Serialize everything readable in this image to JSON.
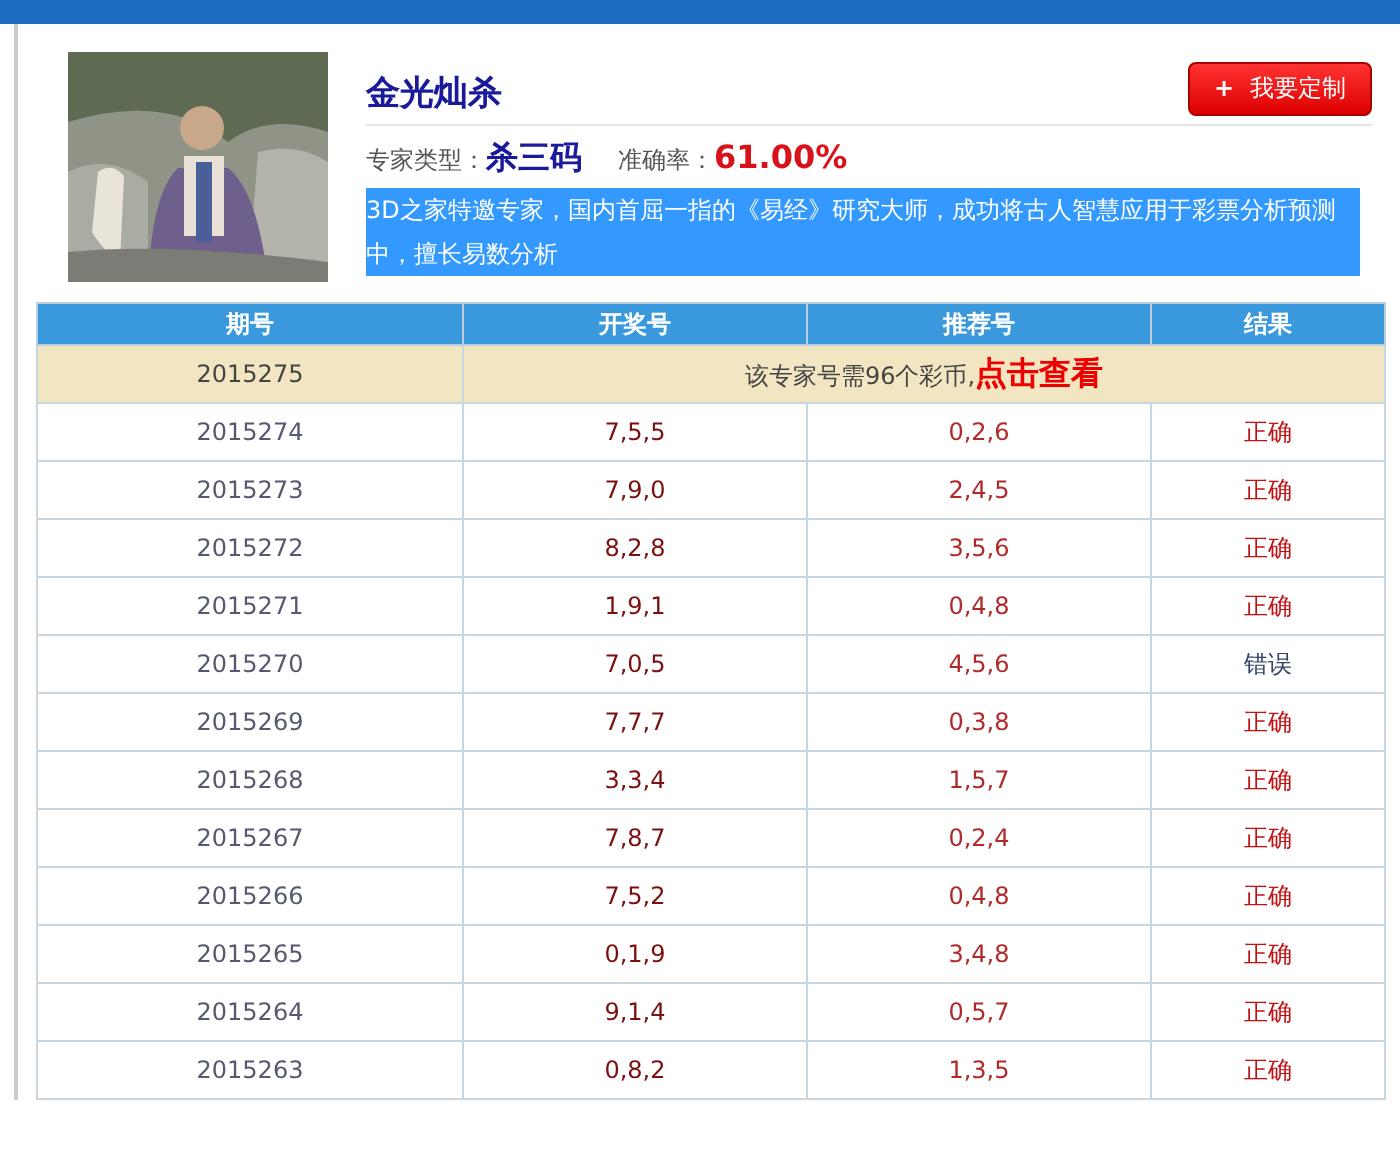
{
  "expert": {
    "name": "金光灿杀",
    "button": "我要定制",
    "button_icon": "+",
    "type_label": "专家类型：",
    "type_value": "杀三码",
    "accuracy_label": "准确率：",
    "accuracy_value": "61.00%",
    "description": "3D之家特邀专家，国内首屈一指的《易经》研究大师，成功将古人智慧应用于彩票分析预测中，擅长易数分析"
  },
  "table": {
    "columns": [
      "期号",
      "开奖号",
      "推荐号",
      "结果"
    ],
    "locked_row": {
      "issue": "2015275",
      "notice": "该专家号需96个彩币,",
      "link": "点击查看"
    },
    "rows": [
      {
        "issue": "2015274",
        "draw": "7,5,5",
        "pick": "0,2,6",
        "result": "正确",
        "correct": true
      },
      {
        "issue": "2015273",
        "draw": "7,9,0",
        "pick": "2,4,5",
        "result": "正确",
        "correct": true
      },
      {
        "issue": "2015272",
        "draw": "8,2,8",
        "pick": "3,5,6",
        "result": "正确",
        "correct": true
      },
      {
        "issue": "2015271",
        "draw": "1,9,1",
        "pick": "0,4,8",
        "result": "正确",
        "correct": true
      },
      {
        "issue": "2015270",
        "draw": "7,0,5",
        "pick": "4,5,6",
        "result": "错误",
        "correct": false
      },
      {
        "issue": "2015269",
        "draw": "7,7,7",
        "pick": "0,3,8",
        "result": "正确",
        "correct": true
      },
      {
        "issue": "2015268",
        "draw": "3,3,4",
        "pick": "1,5,7",
        "result": "正确",
        "correct": true
      },
      {
        "issue": "2015267",
        "draw": "7,8,7",
        "pick": "0,2,4",
        "result": "正确",
        "correct": true
      },
      {
        "issue": "2015266",
        "draw": "7,5,2",
        "pick": "0,4,8",
        "result": "正确",
        "correct": true
      },
      {
        "issue": "2015265",
        "draw": "0,1,9",
        "pick": "3,4,8",
        "result": "正确",
        "correct": true
      },
      {
        "issue": "2015264",
        "draw": "9,1,4",
        "pick": "0,5,7",
        "result": "正确",
        "correct": true
      },
      {
        "issue": "2015263",
        "draw": "0,8,2",
        "pick": "1,3,5",
        "result": "正确",
        "correct": true
      }
    ]
  }
}
